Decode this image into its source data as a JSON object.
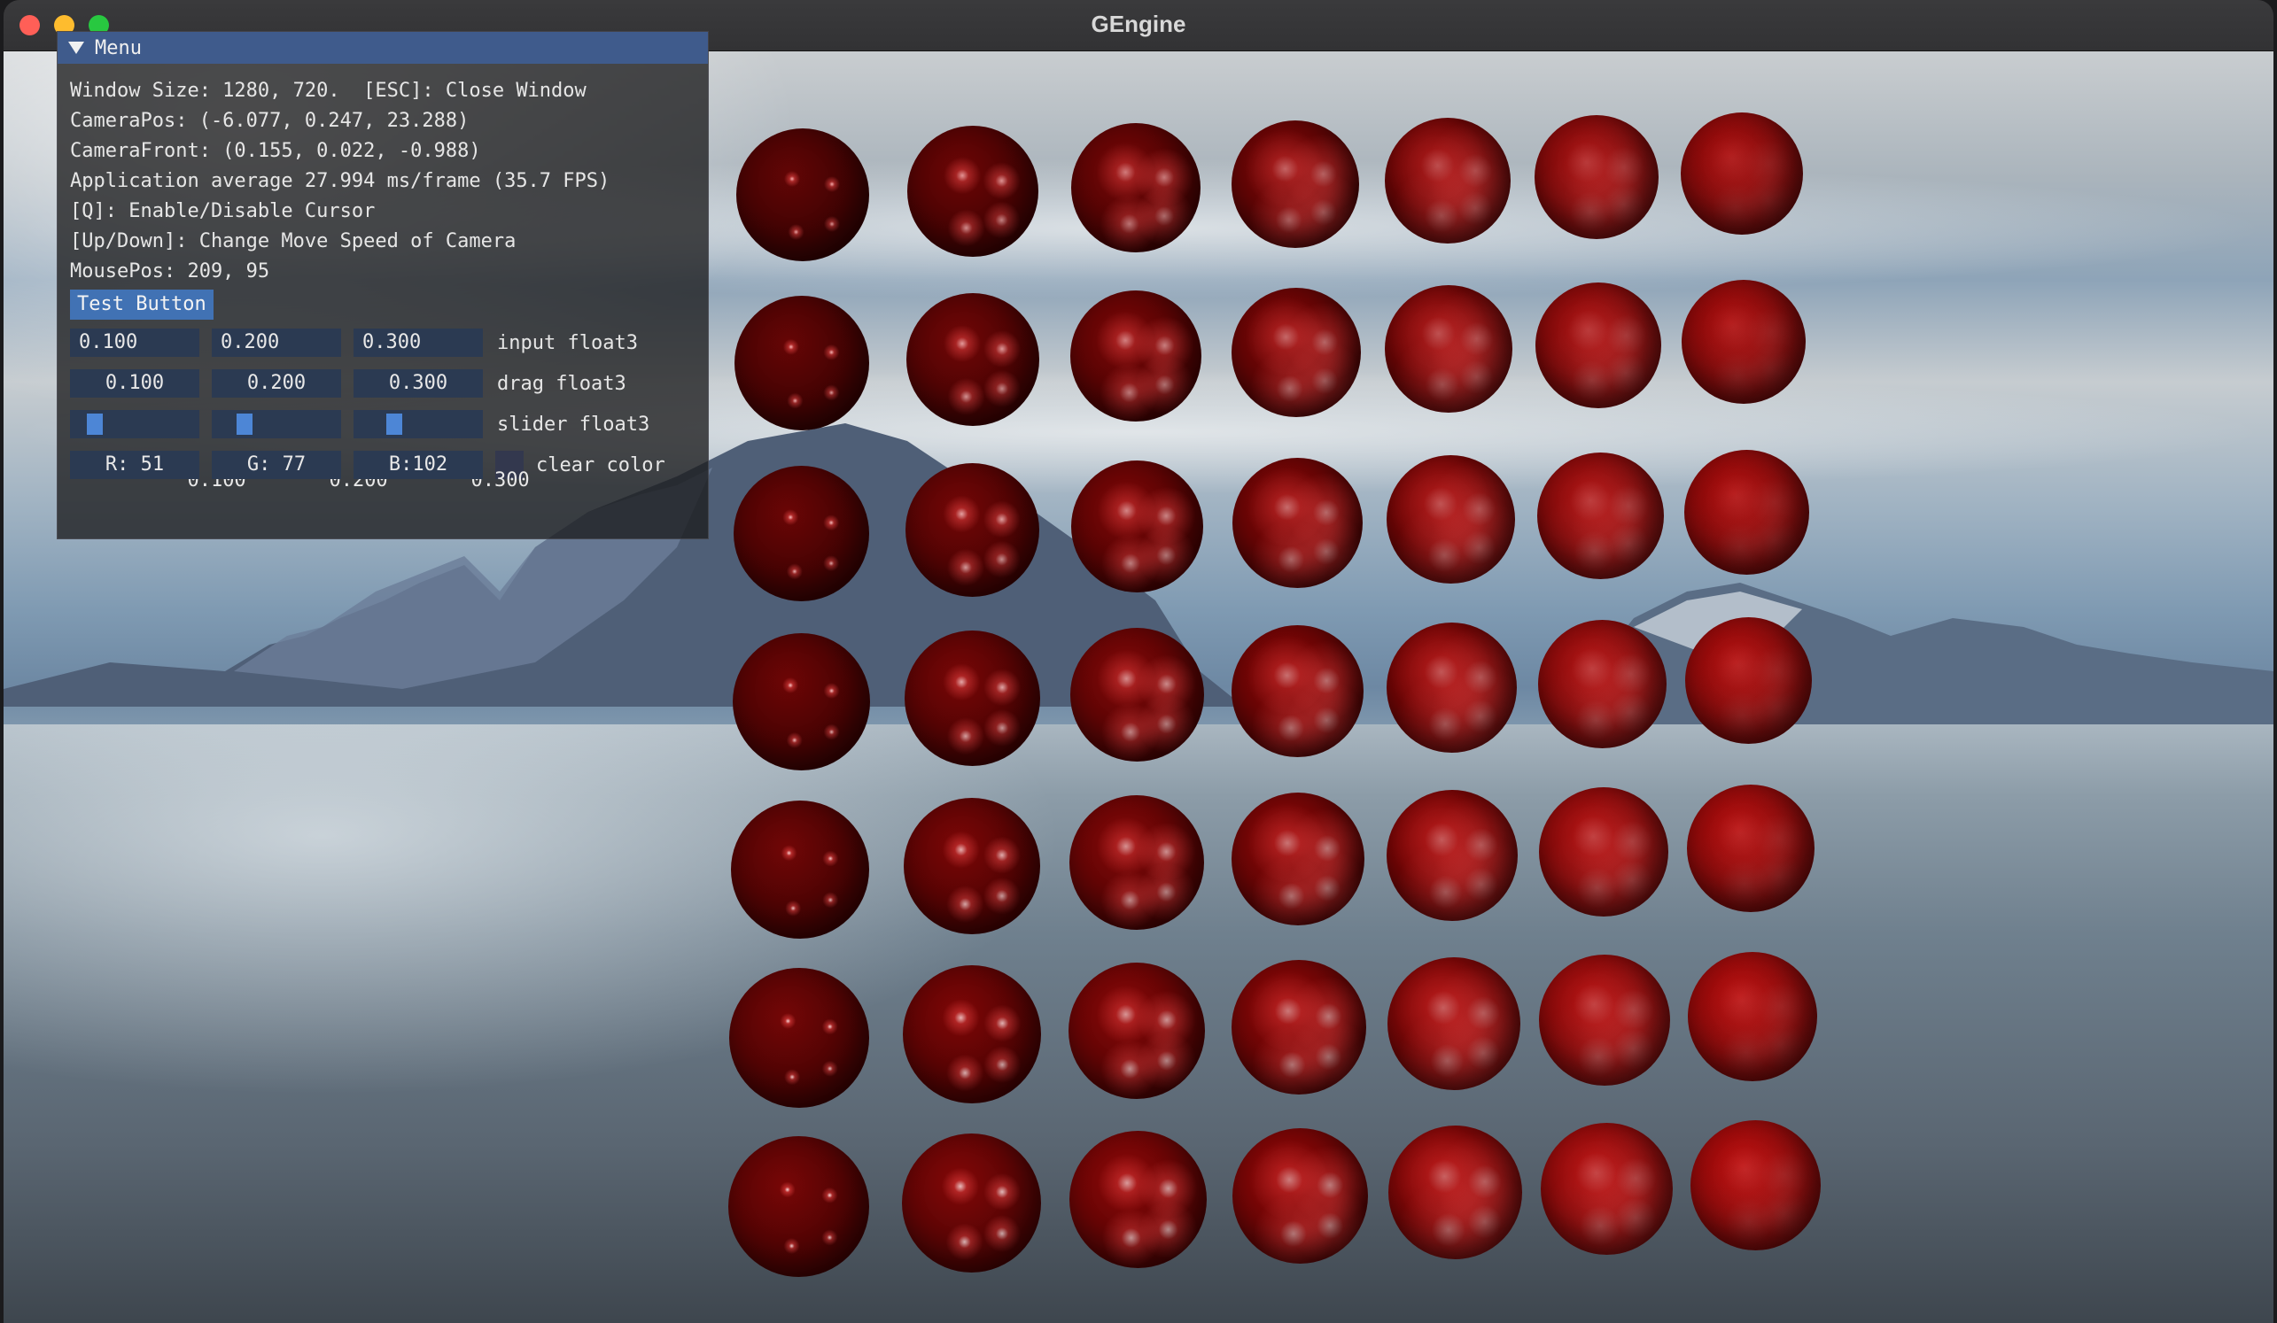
{
  "window": {
    "title": "GEngine",
    "traffic_lights": {
      "close": "#ff5f57",
      "minimize": "#febc2e",
      "maximize": "#28c840"
    }
  },
  "menu": {
    "title": "Menu",
    "lines": [
      "Window Size: 1280, 720.  [ESC]: Close Window",
      "CameraPos: (-6.077, 0.247, 23.288)",
      "CameraFront: (0.155, 0.022, -0.988)",
      "Application average 27.994 ms/frame (35.7 FPS)",
      "[Q]: Enable/Disable Cursor",
      "[Up/Down]: Change Move Speed of Camera",
      "MousePos: 209, 95"
    ],
    "test_button": "Test Button",
    "input_float3": {
      "label": "input float3",
      "values": [
        "0.100",
        "0.200",
        "0.300"
      ]
    },
    "drag_float3": {
      "label": "drag float3",
      "values": [
        "0.100",
        "0.200",
        "0.300"
      ]
    },
    "slider_float3": {
      "label": "slider float3",
      "values": [
        "0.100",
        "0.200",
        "0.300"
      ],
      "levels": [
        0.1,
        0.2,
        0.3
      ]
    },
    "clear_color": {
      "label": "clear color",
      "values": [
        "R: 51",
        "G: 77",
        "B:102"
      ],
      "swatch": "#33384e"
    }
  },
  "scene": {
    "sphere_color": "#8c0a0a",
    "sphere_rows": 7,
    "sphere_cols": 7
  }
}
